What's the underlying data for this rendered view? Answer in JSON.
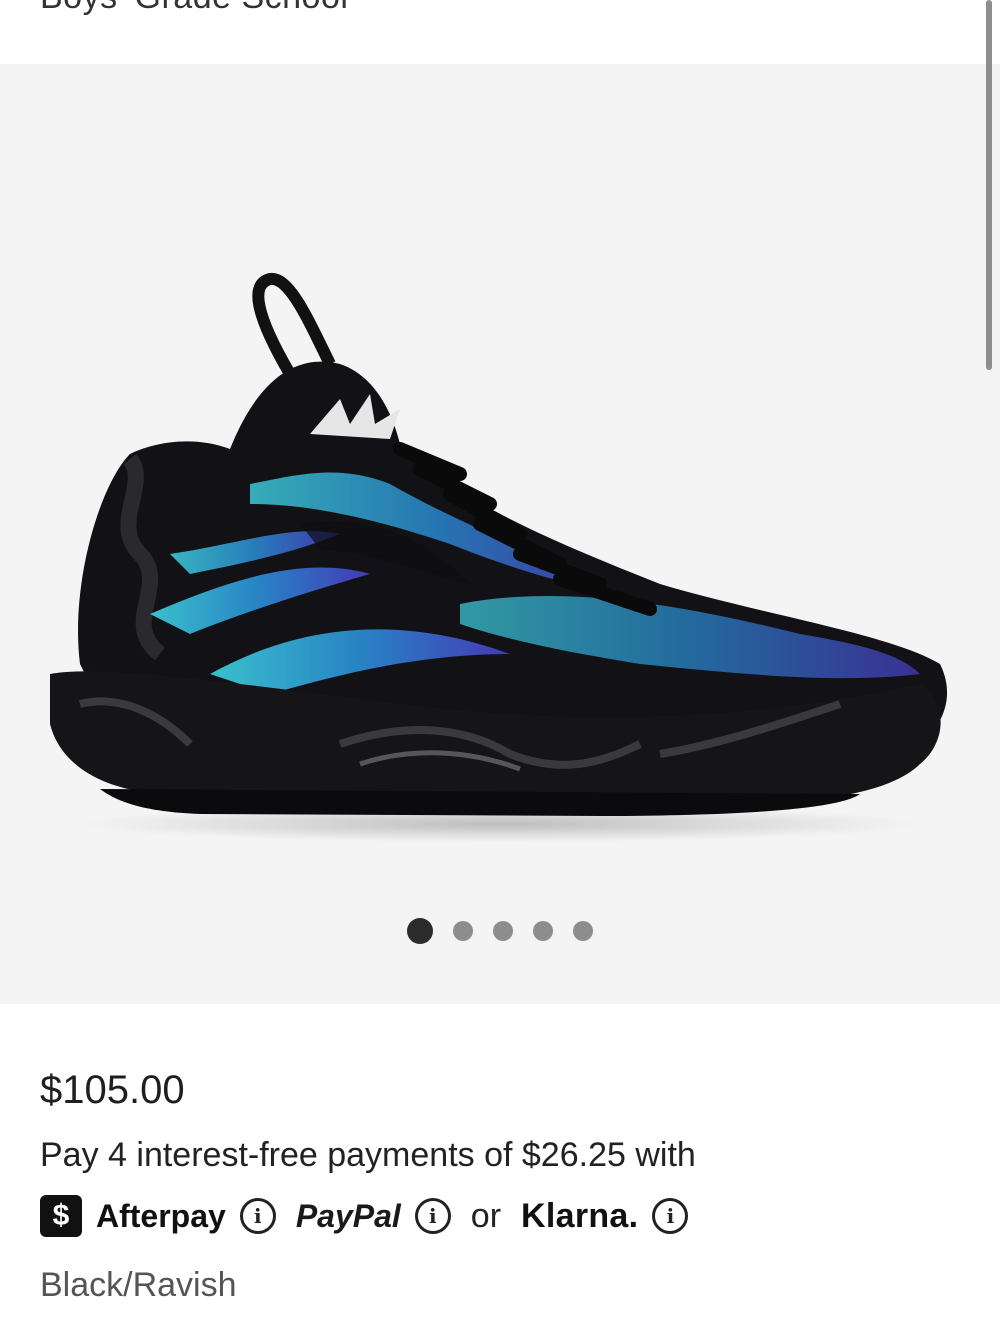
{
  "product": {
    "subtitle": "Boys' Grade School",
    "image_alt": "Black and iridescent blue high-top basketball sneaker",
    "gallery": {
      "total_images": 5,
      "active_index": 0
    }
  },
  "pricing": {
    "price": "$105.00",
    "installment_text": "Pay 4 interest-free payments of $26.25 with",
    "providers": {
      "afterpay_badge": "$",
      "afterpay": "Afterpay",
      "paypal": "PayPal",
      "or": "or",
      "klarna": "Klarna."
    },
    "info_glyph": "i"
  },
  "color": "Black/Ravish"
}
